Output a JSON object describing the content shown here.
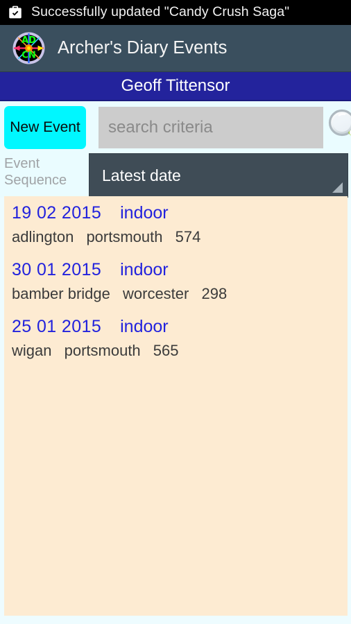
{
  "status_bar": {
    "icon": "briefcase-check-icon",
    "message": "Successfully updated \"Candy Crush Saga\""
  },
  "action_bar": {
    "app_icon": "adcn-compass-logo-icon",
    "title": "Archer's Diary Events"
  },
  "user_bar": {
    "name": "Geoff Tittensor"
  },
  "toolbar": {
    "new_event_label": "New Event",
    "search_placeholder": "search criteria",
    "search_value": "",
    "search_icon": "magnifier-icon"
  },
  "sequence": {
    "label_line1": "Event",
    "label_line2": "Sequence",
    "selected": "Latest date",
    "caret_icon": "spinner-caret-icon"
  },
  "events": [
    {
      "date": "19 02 2015",
      "type": "indoor",
      "club": "adlington",
      "venue": "portsmouth",
      "score": "574"
    },
    {
      "date": "30 01 2015",
      "type": "indoor",
      "club": "bamber bridge",
      "venue": "worcester",
      "score": "298"
    },
    {
      "date": "25 01 2015",
      "type": "indoor",
      "club": "wigan",
      "venue": "portsmouth",
      "score": "565"
    }
  ],
  "colors": {
    "status_bar_bg": "#000000",
    "action_bar_bg": "#3a4f5e",
    "user_bar_bg": "#23239c",
    "page_bg": "#eafcff",
    "list_bg": "#fdebd2",
    "accent_button": "#00f7ff",
    "spinner_bg": "#3f4c56",
    "row_title": "#2222dd",
    "row_detail": "#3b3b3b"
  }
}
